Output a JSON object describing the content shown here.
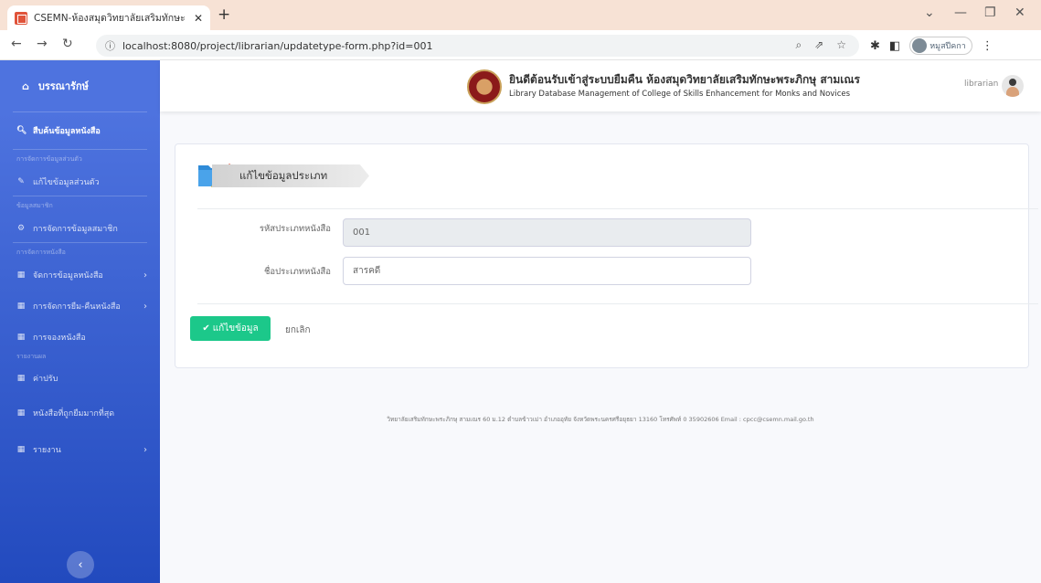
{
  "browser": {
    "tab_title": "CSEMN-ห้องสมุดวิทยาลัยเสริมทักษะ",
    "new_tab": "+",
    "url": "localhost:8080/project/librarian/updatetype-form.php?id=001",
    "profile_name": "หมูสปีคกา"
  },
  "sidebar": {
    "brand": "บรรณารักษ์",
    "search": "สืบค้นข้อมูลหนังสือ",
    "heading_personal": "การจัดการข้อมูลส่วนตัว",
    "edit_profile": "แก้ไขข้อมูลส่วนตัว",
    "heading_members": "ข้อมูลสมาชิก",
    "manage_members": "การจัดการข้อมูลสมาชิก",
    "heading_books": "การจัดการหนังสือ",
    "manage_books": "จัดการข้อมูลหนังสือ",
    "borrow_return": "การจัดการยืม-คืนหนังสือ",
    "reserve": "การจองหนังสือ",
    "heading_reports": "รายงานผล",
    "fines": "ค่าปรับ",
    "popular_books": "หนังสือที่ถูกยืมมากที่สุด",
    "reports": "รายงาน"
  },
  "topbar": {
    "site_title_th": "ยินดีต้อนรับเข้าสู่ระบบยืมคืน ห้องสมุดวิทยาลัยเสริมทักษะพระภิกษุ สามเณร",
    "site_title_en": "Library Database Management of College of Skills Enhancement for Monks and Novices",
    "user": "librarian"
  },
  "form": {
    "header": "แก้ไขข้อมูลประเภท",
    "code_label": "รหัสประเภทหนังสือ",
    "code_value": "001",
    "name_label": "ชื่อประเภทหนังสือ",
    "name_value": "สารคดี",
    "submit": "แก้ไขข้อมูล",
    "cancel": "ยกเลิก"
  },
  "footer": "วิทยาลัยเสริมทักษะพระภิกษุ สามเณร 60 ม.12 ตำบลข้าวเม่า อำเภออุทัย จังหวัดพระนครศรีอยุธยา 13160 โทรศัพท์ 0 35902606 Email : cpcc@csemn.mail.go.th"
}
